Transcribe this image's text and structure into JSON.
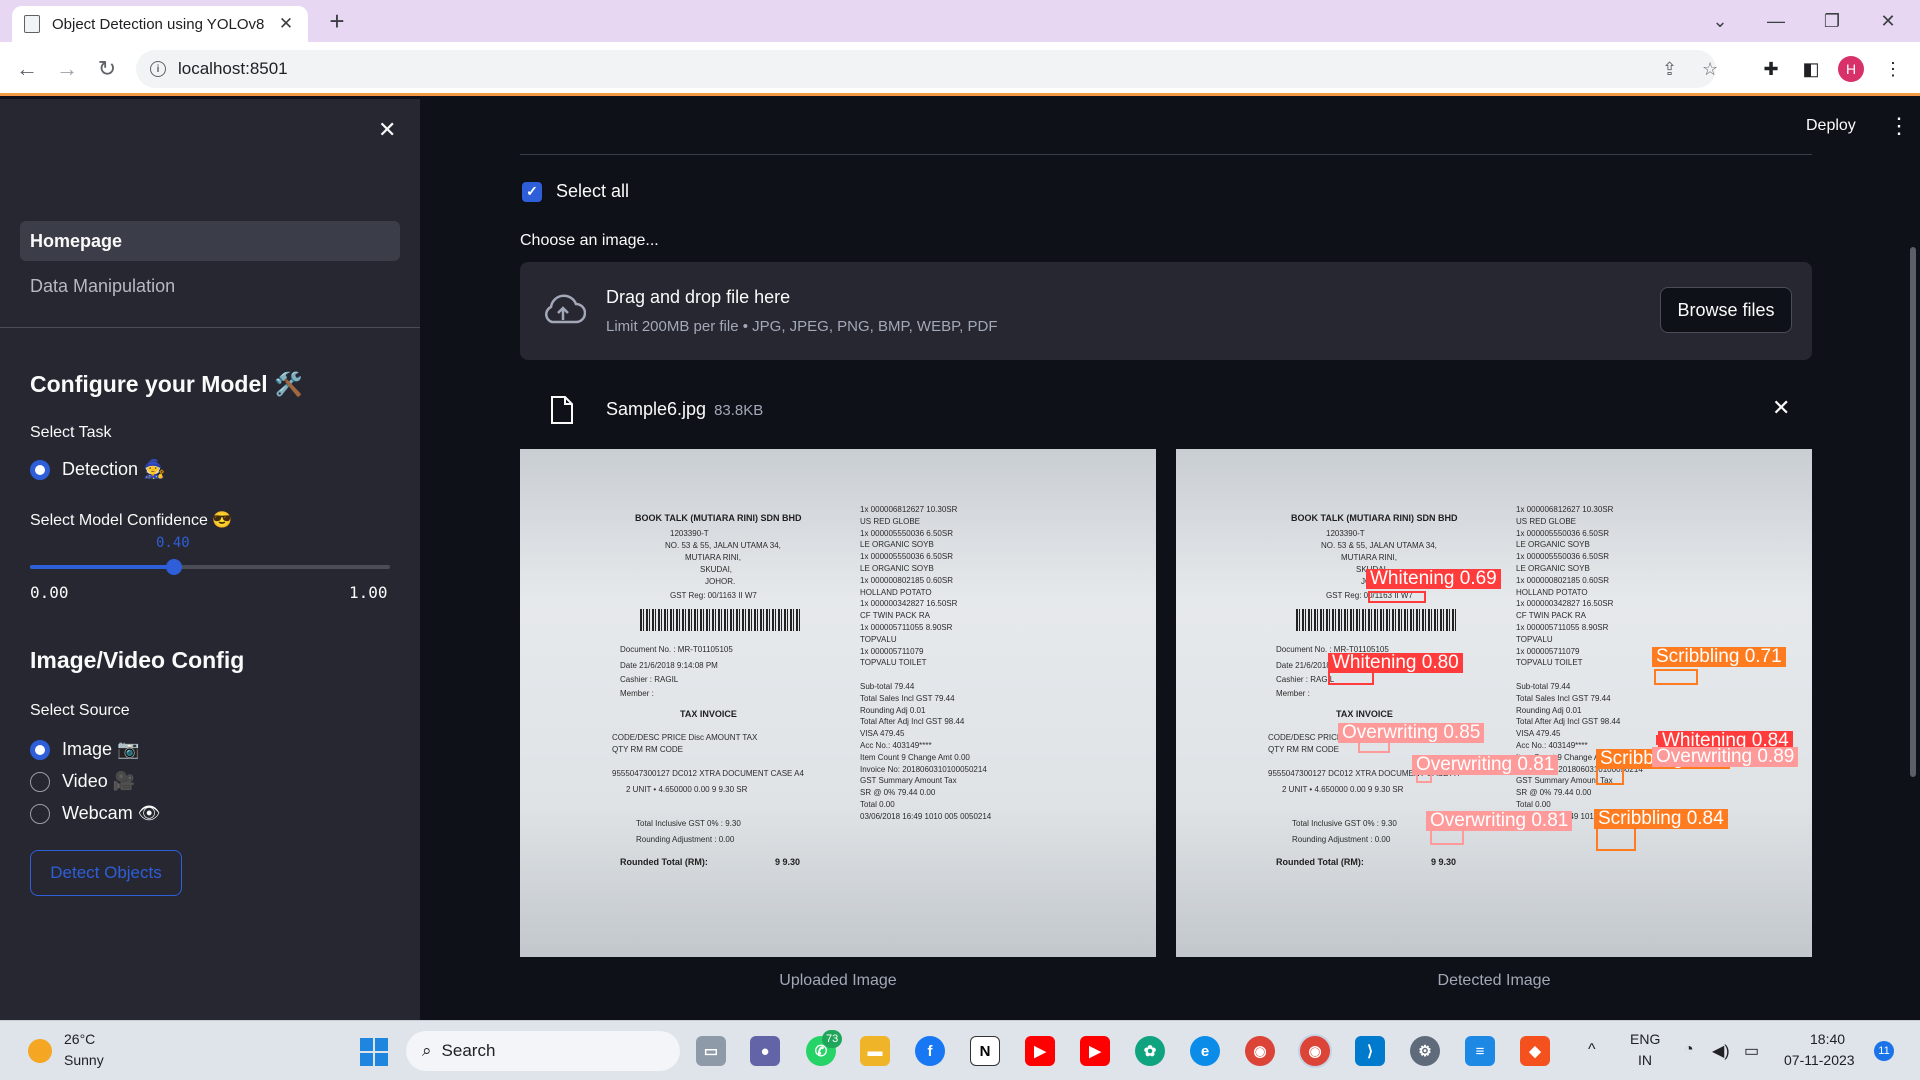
{
  "browser": {
    "tab_title": "Object Detection using YOLOv8",
    "url": "localhost:8501",
    "profile_initial": "H"
  },
  "sidebar": {
    "nav": [
      {
        "label": "Homepage",
        "active": true
      },
      {
        "label": "Data Manipulation",
        "active": false
      }
    ],
    "model_header": "Configure your Model 🛠️",
    "task_label": "Select Task",
    "task_option": "Detection 🧙",
    "confidence_label": "Select Model Confidence 😎",
    "confidence_value": "0.40",
    "confidence_fraction": 0.4,
    "confidence_min": "0.00",
    "confidence_max": "1.00",
    "source_header": "Image/Video Config",
    "source_label": "Select Source",
    "sources": [
      {
        "label": "Image 📷",
        "selected": true
      },
      {
        "label": "Video 🎥",
        "selected": false
      },
      {
        "label": "Webcam 👁",
        "selected": false
      }
    ],
    "detect_button": "Detect Objects"
  },
  "main": {
    "deploy_label": "Deploy",
    "select_all_label": "Select all",
    "choose_label": "Choose an image...",
    "dropzone_title": "Drag and drop file here",
    "dropzone_sub": "Limit 200MB per file • JPG, JPEG, PNG, BMP, WEBP, PDF",
    "browse_label": "Browse files",
    "file_name": "Sample6.jpg",
    "file_size": "83.8KB",
    "uploaded_caption": "Uploaded Image",
    "detected_caption": "Detected Image"
  },
  "receipt": {
    "store": "BOOK TALK (MUTIARA RINI) SDN BHD",
    "reg": "1203390-T",
    "addr1": "NO. 53 & 55, JALAN UTAMA 34,",
    "addr2": "MUTIARA RINI,",
    "addr3": "SKUDAI,",
    "addr4": "JOHOR.",
    "gst": "GST Reg: 00/1163 II W7",
    "doc_no": "Document No. : MR-T01105105",
    "date": "Date        21/6/2018 9:14:08 PM",
    "cashier": "Cashier :   RAGIL",
    "member": "Member :",
    "tax_invoice": "TAX INVOICE",
    "cols": "CODE/DESC    PRICE   Disc   AMOUNT   TAX",
    "cols2": "QTY                  RM            RM   CODE",
    "item": "9555047300127   DC012 XTRA DOCUMENT CASE A4",
    "item_qty": "2 UNIT  •  4.650000   0.00    9 9.30   SR",
    "total_incl": "Total Inclusive GST 0% :                9.30",
    "rounding": "Rounding Adjustment :                   0.00",
    "rounded_total": "Rounded Total (RM):",
    "rounded_value": "9 9.30",
    "right_lines": [
      "1x 000006812627              10.30SR",
      "   US RED GLOBE",
      "1x 000005550036              6.50SR",
      "   LE ORGANIC SOYB",
      "1x 000005550036              6.50SR",
      "   LE ORGANIC SOYB",
      "1x 000000802185              0.60SR",
      "   HOLLAND POTATO",
      "1x 000000342827             16.50SR",
      "   CF TWIN PACK RA",
      "1x 000005711055              8.90SR",
      "   TOPVALU",
      "1x 000005711079",
      "   TOPVALU TOILET",
      "",
      "Sub-total                    79.44",
      "Total Sales Incl GST         79.44",
      "Rounding Adj                  0.01",
      "Total After Adj Incl GST     98.44",
      "VISA                        479.45",
      "Acc No.: 403149****",
      "Item Count 9      Change Amt   0.00",
      "  Invoice No: 2018060310100050214",
      "GST Summary      Amount        Tax",
      "SR @ 0%          79.44        0.00",
      "Total                         0.00",
      "03/06/2018 16:49    1010 005 0050214"
    ]
  },
  "detections": [
    {
      "label": "Whitening 0.69",
      "color": "#ff3b3b"
    },
    {
      "label": "Whitening 0.80",
      "color": "#ff3b3b"
    },
    {
      "label": "Scribbling 0.71",
      "color": "#ff7b1f"
    },
    {
      "label": "Overwriting 0.85",
      "color": "#ff9a9a"
    },
    {
      "label": "Overwriting 0.81",
      "color": "#ff9a9a"
    },
    {
      "label": "Scribbling 0.55",
      "color": "#ff7b1f"
    },
    {
      "label": "Whitening 0.84",
      "color": "#ff3b3b"
    },
    {
      "label": "Overwriting 0.89",
      "color": "#ff9a9a"
    },
    {
      "label": "Overwriting 0.81",
      "color": "#ff9a9a"
    },
    {
      "label": "Scribbling 0.84",
      "color": "#ff7b1f"
    }
  ],
  "taskbar": {
    "temp": "26°C",
    "weather": "Sunny",
    "search_label": "Search",
    "whatsapp_badge": "73",
    "lang1": "ENG",
    "lang2": "IN",
    "time": "18:40",
    "date": "07-11-2023",
    "notifications": "11"
  }
}
